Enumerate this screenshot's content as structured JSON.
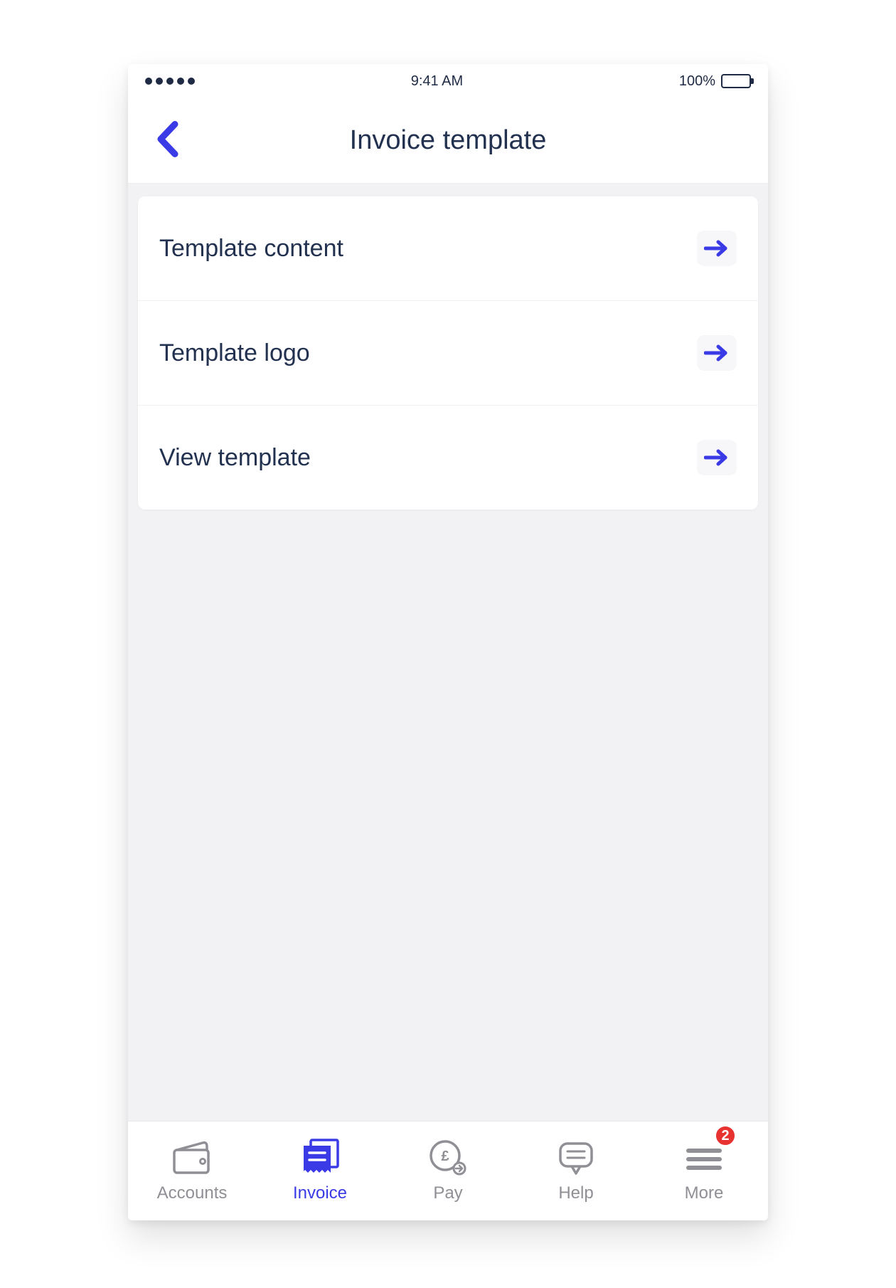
{
  "colors": {
    "accent": "#3a3ae6",
    "text_dark": "#22314f",
    "muted": "#8f8f95",
    "badge": "#e7322f"
  },
  "status": {
    "time": "9:41 AM",
    "battery_text": "100%"
  },
  "header": {
    "title": "Invoice template"
  },
  "list": {
    "items": [
      {
        "label": "Template content"
      },
      {
        "label": "Template logo"
      },
      {
        "label": "View template"
      }
    ]
  },
  "tabs": {
    "items": [
      {
        "label": "Accounts",
        "icon": "wallet-icon",
        "active": false
      },
      {
        "label": "Invoice",
        "icon": "invoice-icon",
        "active": true
      },
      {
        "label": "Pay",
        "icon": "pay-icon",
        "active": false
      },
      {
        "label": "Help",
        "icon": "help-icon",
        "active": false
      },
      {
        "label": "More",
        "icon": "more-icon",
        "active": false,
        "badge": "2"
      }
    ]
  }
}
